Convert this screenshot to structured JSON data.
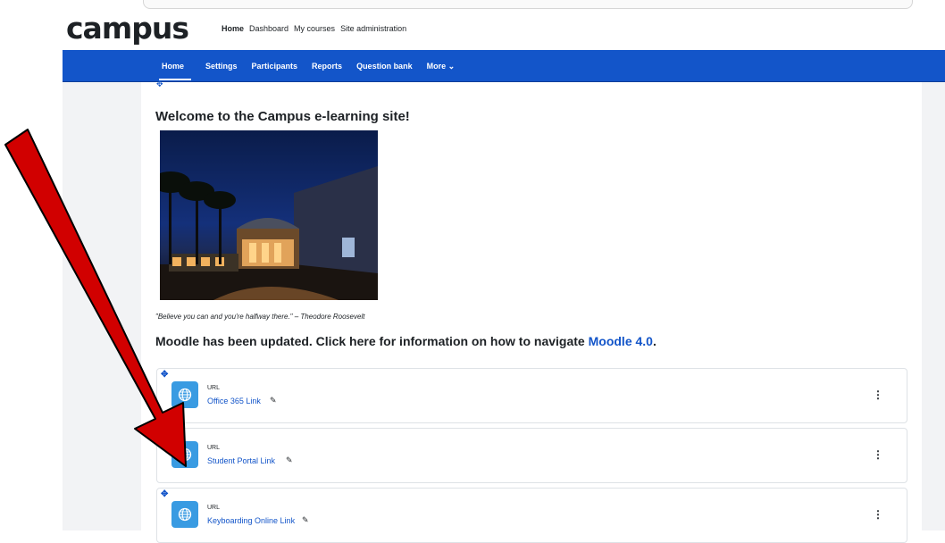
{
  "site": {
    "logo": "campus"
  },
  "primary_nav": [
    "Home",
    "Dashboard",
    "My courses",
    "Site administration"
  ],
  "secondary_nav": [
    "Home",
    "Settings",
    "Participants",
    "Reports",
    "Question bank",
    "More ⌄"
  ],
  "content": {
    "welcome": "Welcome to the Campus e-learning site!",
    "quote": "\"Believe you can and you're halfway there.\" – Theodore Roosevelt",
    "update_text": "Moodle has been updated. Click here for information on how to navigate ",
    "update_link": "Moodle 4.0",
    "update_end": "."
  },
  "activities": [
    {
      "type": "URL",
      "name": "Office 365 Link"
    },
    {
      "type": "URL",
      "name": "Student Portal Link"
    },
    {
      "type": "URL",
      "name": "Keyboarding Online Link"
    }
  ],
  "icons": {
    "move": "✥",
    "edit": "✎",
    "menu": "⋮"
  },
  "colors": {
    "brand_blue": "#1355c9",
    "activity_icon": "#399be2",
    "annotation_arrow": "#d10000"
  }
}
